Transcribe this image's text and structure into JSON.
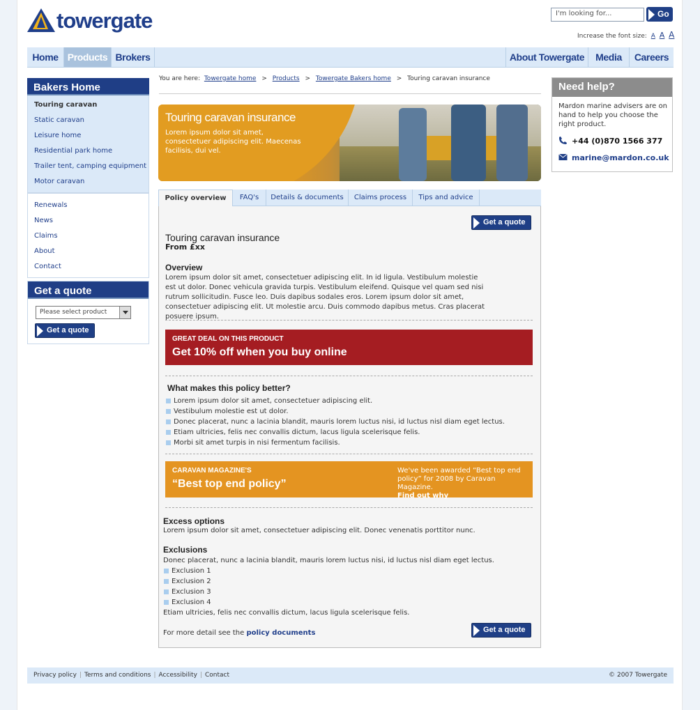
{
  "header": {
    "logo_text": "towergate",
    "search_placeholder": "I'm looking for...",
    "search_button": "Go",
    "font_size_label": "Increase the font size:",
    "font_size_options": [
      "A",
      "A",
      "A"
    ]
  },
  "nav": {
    "left": [
      "Home",
      "Products",
      "Brokers"
    ],
    "right": [
      "About Towergate",
      "Media",
      "Careers"
    ],
    "active": "Products"
  },
  "sidebar": {
    "title": "Bakers Home",
    "items": [
      "Touring caravan",
      "Static caravan",
      "Leisure home",
      "Residential park home",
      "Trailer tent, camping equipment",
      "Motor caravan"
    ],
    "current": "Touring caravan",
    "items2": [
      "Renewals",
      "News",
      "Claims",
      "About",
      "Contact"
    ]
  },
  "quote_box": {
    "title": "Get a quote",
    "select_value": "Please select product",
    "button": "Get a quote"
  },
  "breadcrumb": {
    "prefix": "You are here:",
    "links": [
      "Towergate home",
      "Products",
      "Towergate Bakers home"
    ],
    "current": "Touring caravan insurance",
    "separator": ">"
  },
  "hero": {
    "title": "Touring caravan insurance",
    "text": "Lorem ipsum dolor sit amet, consectetuer adipiscing elit. Maecenas facilisis, dui vel."
  },
  "tabs": [
    "Policy overview",
    "FAQ's",
    "Details & documents",
    "Claims process",
    "Tips and advice"
  ],
  "main": {
    "quote_button": "Get a quote",
    "title": "Touring caravan insurance",
    "price": "From £xx",
    "overview_heading": "Overview",
    "overview_text": "Lorem ipsum dolor sit amet, consectetuer adipiscing elit. In id ligula. Vestibulum molestie est ut dolor. Donec vehicula gravida turpis. Vestibulum eleifend. Quisque vel quam sed nisi rutrum sollicitudin.  Fusce leo. Duis dapibus sodales eros. Lorem ipsum dolor sit amet, consectetuer adipiscing elit. Ut molestie arcu. Duis commodo dapibus metus. Cras placerat posuere ipsum.",
    "deal_small": "GREAT DEAL ON THIS PRODUCT",
    "deal_big": "Get 10% off when you buy online",
    "better_heading": "What makes this policy better?",
    "better_items": [
      "Lorem ipsum dolor sit amet, consectetuer adipiscing elit.",
      "Vestibulum molestie est ut dolor.",
      "Donec placerat, nunc a lacinia blandit, mauris lorem luctus nisi, id luctus nisl diam eget lectus.",
      "Etiam ultricies, felis nec convallis dictum, lacus ligula scelerisque felis.",
      "Morbi sit amet turpis in nisi fermentum facilisis."
    ],
    "award_small": "CARAVAN MAGAZINE'S",
    "award_big": "“Best top end policy”",
    "award_text": "We've been awarded “Best top end policy” for 2008 by Caravan Magazine.",
    "award_link": "Find out why",
    "excess_heading": "Excess options",
    "excess_text": "Lorem ipsum dolor sit amet, consectetuer adipiscing elit. Donec venenatis porttitor nunc.",
    "exclusions_heading": "Exclusions",
    "exclusions_intro": "Donec placerat, nunc a lacinia blandit, mauris lorem luctus nisi, id luctus nisl diam eget lectus.",
    "exclusions": [
      "Exclusion 1",
      "Exclusion 2",
      "Exclusion 3",
      "Exclusion 4"
    ],
    "exclusions_outro": "Etiam ultricies, felis nec convallis dictum, lacus ligula scelerisque felis.",
    "more_detail_prefix": "For more detail see the",
    "more_detail_link": "policy documents",
    "quote_button_bottom": "Get a quote"
  },
  "help": {
    "title": "Need help?",
    "text": "Mardon marine advisers are on hand to help you choose the right product.",
    "phone": "+44 (0)870 1566 377",
    "email": "marine@mardon.co.uk"
  },
  "footer": {
    "links": [
      "Privacy policy",
      "Terms and conditions",
      "Accessibility",
      "Contact"
    ],
    "copyright": "© 2007 Towergate"
  },
  "colors": {
    "brand_blue": "#1f3e86",
    "deal_red": "#a51d22",
    "award_orange": "#e49421",
    "nav_bg": "#dbe9f8"
  }
}
